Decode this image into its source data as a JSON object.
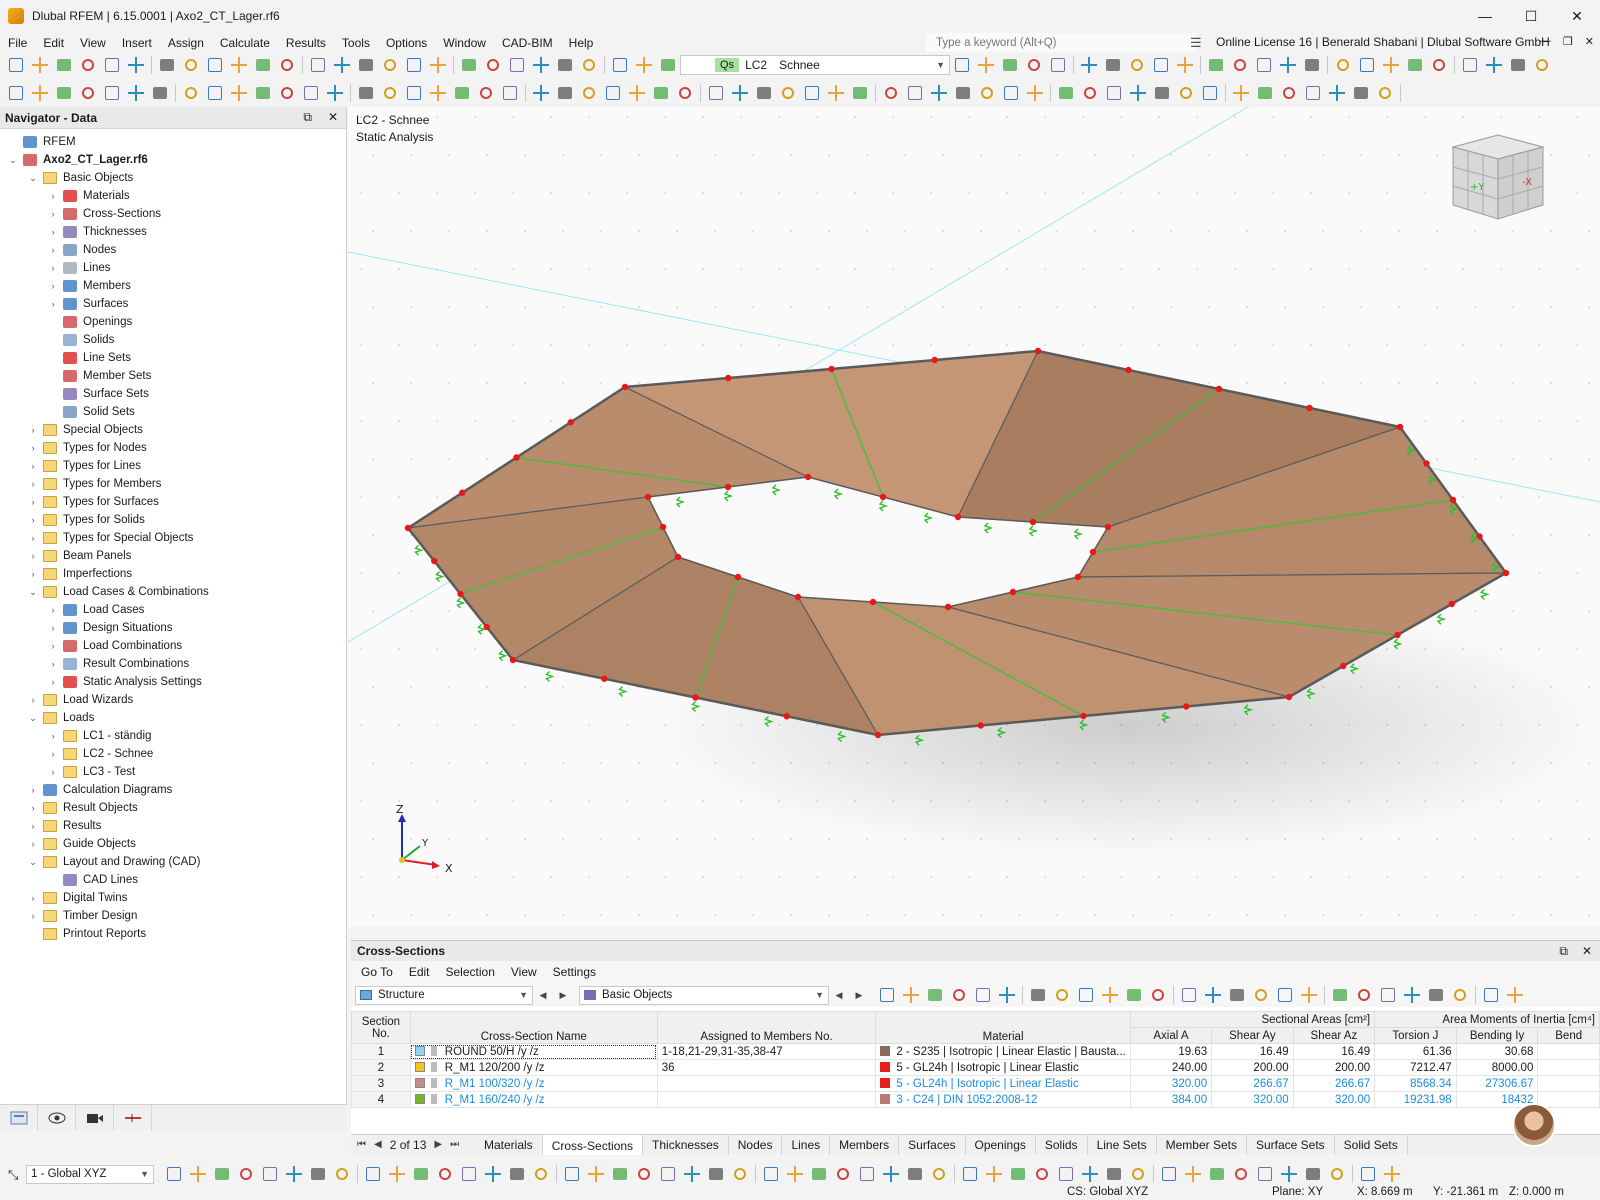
{
  "window": {
    "title": "Dlubal RFEM | 6.15.0001 | Axo2_CT_Lager.rf6",
    "minimize": "—",
    "maximize": "☐",
    "close": "✕"
  },
  "menu": {
    "items": [
      "File",
      "Edit",
      "View",
      "Insert",
      "Assign",
      "Calculate",
      "Results",
      "Tools",
      "Options",
      "Window",
      "CAD-BIM",
      "Help"
    ],
    "search_placeholder": "Type a keyword (Alt+Q)",
    "license": "Online License 16 | Benerald Shabani | Dlubal Software GmbH"
  },
  "toolbar": {
    "lc_tag": "Qs",
    "lc_id": "LC2",
    "lc_name": "Schnee"
  },
  "navigator": {
    "title": "Navigator - Data",
    "tree": [
      {
        "label": "RFEM",
        "level": 0,
        "toggle": "",
        "icon": "rfem-icon",
        "bold": false
      },
      {
        "label": "Axo2_CT_Lager.rf6",
        "level": 0,
        "toggle": "⌄",
        "icon": "model-file-icon",
        "bold": true
      },
      {
        "label": "Basic Objects",
        "level": 1,
        "toggle": "⌄",
        "icon": "folder-icon"
      },
      {
        "label": "Materials",
        "level": 2,
        "toggle": "›",
        "icon": "materials-icon"
      },
      {
        "label": "Cross-Sections",
        "level": 2,
        "toggle": "›",
        "icon": "cross-sections-icon"
      },
      {
        "label": "Thicknesses",
        "level": 2,
        "toggle": "›",
        "icon": "thicknesses-icon"
      },
      {
        "label": "Nodes",
        "level": 2,
        "toggle": "›",
        "icon": "nodes-icon"
      },
      {
        "label": "Lines",
        "level": 2,
        "toggle": "›",
        "icon": "lines-icon"
      },
      {
        "label": "Members",
        "level": 2,
        "toggle": "›",
        "icon": "members-icon"
      },
      {
        "label": "Surfaces",
        "level": 2,
        "toggle": "›",
        "icon": "surfaces-icon"
      },
      {
        "label": "Openings",
        "level": 2,
        "toggle": "",
        "icon": "openings-icon"
      },
      {
        "label": "Solids",
        "level": 2,
        "toggle": "",
        "icon": "solids-icon"
      },
      {
        "label": "Line Sets",
        "level": 2,
        "toggle": "",
        "icon": "line-sets-icon"
      },
      {
        "label": "Member Sets",
        "level": 2,
        "toggle": "",
        "icon": "member-sets-icon"
      },
      {
        "label": "Surface Sets",
        "level": 2,
        "toggle": "",
        "icon": "surface-sets-icon"
      },
      {
        "label": "Solid Sets",
        "level": 2,
        "toggle": "",
        "icon": "solid-sets-icon"
      },
      {
        "label": "Special Objects",
        "level": 1,
        "toggle": "›",
        "icon": "folder-icon"
      },
      {
        "label": "Types for Nodes",
        "level": 1,
        "toggle": "›",
        "icon": "folder-icon"
      },
      {
        "label": "Types for Lines",
        "level": 1,
        "toggle": "›",
        "icon": "folder-icon"
      },
      {
        "label": "Types for Members",
        "level": 1,
        "toggle": "›",
        "icon": "folder-icon"
      },
      {
        "label": "Types for Surfaces",
        "level": 1,
        "toggle": "›",
        "icon": "folder-icon"
      },
      {
        "label": "Types for Solids",
        "level": 1,
        "toggle": "›",
        "icon": "folder-icon"
      },
      {
        "label": "Types for Special Objects",
        "level": 1,
        "toggle": "›",
        "icon": "folder-icon"
      },
      {
        "label": "Beam Panels",
        "level": 1,
        "toggle": "›",
        "icon": "folder-icon"
      },
      {
        "label": "Imperfections",
        "level": 1,
        "toggle": "›",
        "icon": "folder-icon"
      },
      {
        "label": "Load Cases & Combinations",
        "level": 1,
        "toggle": "⌄",
        "icon": "folder-icon"
      },
      {
        "label": "Load Cases",
        "level": 2,
        "toggle": "›",
        "icon": "load-cases-icon"
      },
      {
        "label": "Design Situations",
        "level": 2,
        "toggle": "›",
        "icon": "design-situations-icon"
      },
      {
        "label": "Load Combinations",
        "level": 2,
        "toggle": "›",
        "icon": "load-combinations-icon"
      },
      {
        "label": "Result Combinations",
        "level": 2,
        "toggle": "›",
        "icon": "result-combinations-icon"
      },
      {
        "label": "Static Analysis Settings",
        "level": 2,
        "toggle": "›",
        "icon": "static-analysis-settings-icon"
      },
      {
        "label": "Load Wizards",
        "level": 1,
        "toggle": "›",
        "icon": "folder-icon"
      },
      {
        "label": "Loads",
        "level": 1,
        "toggle": "⌄",
        "icon": "folder-icon"
      },
      {
        "label": "LC1 - ständig",
        "level": 2,
        "toggle": "›",
        "icon": "folder-icon"
      },
      {
        "label": "LC2 - Schnee",
        "level": 2,
        "toggle": "›",
        "icon": "folder-icon"
      },
      {
        "label": "LC3 - Test",
        "level": 2,
        "toggle": "›",
        "icon": "folder-icon"
      },
      {
        "label": "Calculation Diagrams",
        "level": 1,
        "toggle": "›",
        "icon": "calculation-diagrams-icon"
      },
      {
        "label": "Result Objects",
        "level": 1,
        "toggle": "›",
        "icon": "folder-icon"
      },
      {
        "label": "Results",
        "level": 1,
        "toggle": "›",
        "icon": "folder-icon"
      },
      {
        "label": "Guide Objects",
        "level": 1,
        "toggle": "›",
        "icon": "folder-icon"
      },
      {
        "label": "Layout and Drawing (CAD)",
        "level": 1,
        "toggle": "⌄",
        "icon": "folder-icon"
      },
      {
        "label": "CAD Lines",
        "level": 2,
        "toggle": "",
        "icon": "cad-lines-icon"
      },
      {
        "label": "Digital Twins",
        "level": 1,
        "toggle": "›",
        "icon": "folder-icon"
      },
      {
        "label": "Timber Design",
        "level": 1,
        "toggle": "›",
        "icon": "folder-icon"
      },
      {
        "label": "Printout Reports",
        "level": 1,
        "toggle": "",
        "icon": "folder-icon"
      }
    ]
  },
  "viewport": {
    "line1": "LC2 - Schnee",
    "line2": "Static Analysis",
    "axis_x": "X",
    "axis_y": "Y",
    "axis_z": "Z",
    "cube_face_y": "+Y",
    "cube_face_x": "-X"
  },
  "cross_sections": {
    "title": "Cross-Sections",
    "menu": [
      "Go To",
      "Edit",
      "Selection",
      "View",
      "Settings"
    ],
    "structure_combo": "Structure",
    "filter_combo": "Basic Objects",
    "group_areas": "Sectional Areas [cm²]",
    "group_moments": "Area Moments of Inertia [cm⁴]",
    "columns": [
      "Section No.",
      "Cross-Section Name",
      "Assigned to Members No.",
      "Material",
      "Axial A",
      "Shear Ay",
      "Shear Az",
      "Torsion J",
      "Bending Iy",
      "Bend"
    ],
    "rows": [
      {
        "no": "1",
        "color": "#8fd3f4",
        "name": "ROUND 50/H /y /z",
        "members": "1-18,21-29,31-35,38-47",
        "mat_color": "#8a6a55",
        "material": "2 - S235 | Isotropic | Linear Elastic | Bausta...",
        "A": "19.63",
        "Ay": "16.49",
        "Az": "16.49",
        "J": "61.36",
        "Iy": "30.68",
        "blue": false
      },
      {
        "no": "2",
        "color": "#f5c518",
        "name": "R_M1 120/200 /y /z",
        "members": "36",
        "mat_color": "#e8201c",
        "material": "5 - GL24h | Isotropic | Linear Elastic",
        "A": "240.00",
        "Ay": "200.00",
        "Az": "200.00",
        "J": "7212.47",
        "Iy": "8000.00",
        "blue": false
      },
      {
        "no": "3",
        "color": "#c98a8a",
        "name": "R_M1 100/320 /y /z",
        "members": "",
        "mat_color": "#e8201c",
        "material": "5 - GL24h | Isotropic | Linear Elastic",
        "A": "320.00",
        "Ay": "266.67",
        "Az": "266.67",
        "J": "8568.34",
        "Iy": "27306.67",
        "blue": true
      },
      {
        "no": "4",
        "color": "#74b82a",
        "name": "R_M1 160/240 /y /z",
        "members": "",
        "mat_color": "#b87a72",
        "material": "3 - C24 | DIN 1052:2008-12",
        "A": "384.00",
        "Ay": "320.00",
        "Az": "320.00",
        "J": "19231.98",
        "Iy": "18432",
        "blue": true
      }
    ],
    "pager": "2 of 13",
    "tabs": [
      "Materials",
      "Cross-Sections",
      "Thicknesses",
      "Nodes",
      "Lines",
      "Members",
      "Surfaces",
      "Openings",
      "Solids",
      "Line Sets",
      "Member Sets",
      "Surface Sets",
      "Solid Sets"
    ],
    "active_tab": "Cross-Sections"
  },
  "status": {
    "cs_combo": "1 - Global XYZ",
    "cs": "CS: Global XYZ",
    "plane": "Plane: XY",
    "x": "X: 8.669 m",
    "y": "Y: -21.361 m",
    "z": "Z: 0.000 m"
  }
}
